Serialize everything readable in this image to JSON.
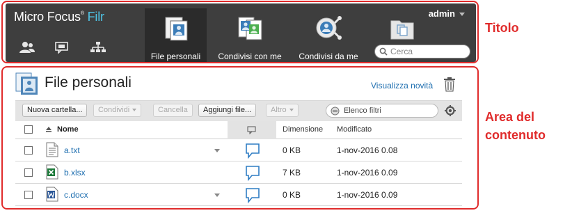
{
  "header": {
    "brand": "Micro Focus",
    "brand_product": "Filr",
    "brand_mark": "®",
    "user": "admin",
    "tabs": [
      {
        "label": "File personali",
        "icon": "my-files-icon",
        "active": true
      },
      {
        "label": "Condivisi con me",
        "icon": "shared-with-me-icon",
        "active": false
      },
      {
        "label": "Condivisi da me",
        "icon": "shared-by-me-icon",
        "active": false
      },
      {
        "label": "",
        "icon": "net-folders-icon",
        "active": false
      }
    ],
    "small_icons": [
      "people-icon",
      "comments-icon",
      "hierarchy-icon"
    ],
    "search_placeholder": "Cerca"
  },
  "callouts": {
    "title": "Titolo",
    "content_line1": "Area del",
    "content_line2": "contenuto"
  },
  "content": {
    "title": "File personali",
    "whats_new": "Visualizza novità",
    "toolbar": {
      "new_folder": "Nuova cartella...",
      "share": "Condividi",
      "delete": "Cancella",
      "add_files": "Aggiungi file...",
      "more": "Altro",
      "filter_list": "Elenco filtri"
    },
    "columns": {
      "name": "Nome",
      "size": "Dimensione",
      "modified": "Modificato"
    },
    "rows": [
      {
        "name": "a.txt",
        "type": "txt",
        "size": "0 KB",
        "modified": "1-nov-2016 0.08"
      },
      {
        "name": "b.xlsx",
        "type": "xlsx",
        "size": "7 KB",
        "modified": "1-nov-2016 0.09"
      },
      {
        "name": "c.docx",
        "type": "docx",
        "size": "0 KB",
        "modified": "1-nov-2016 0.09"
      }
    ]
  },
  "colors": {
    "header_bg": "#3e3e3e",
    "accent": "#4fc4e6",
    "link": "#1f6fb0",
    "callout_red": "#e02b2b"
  }
}
